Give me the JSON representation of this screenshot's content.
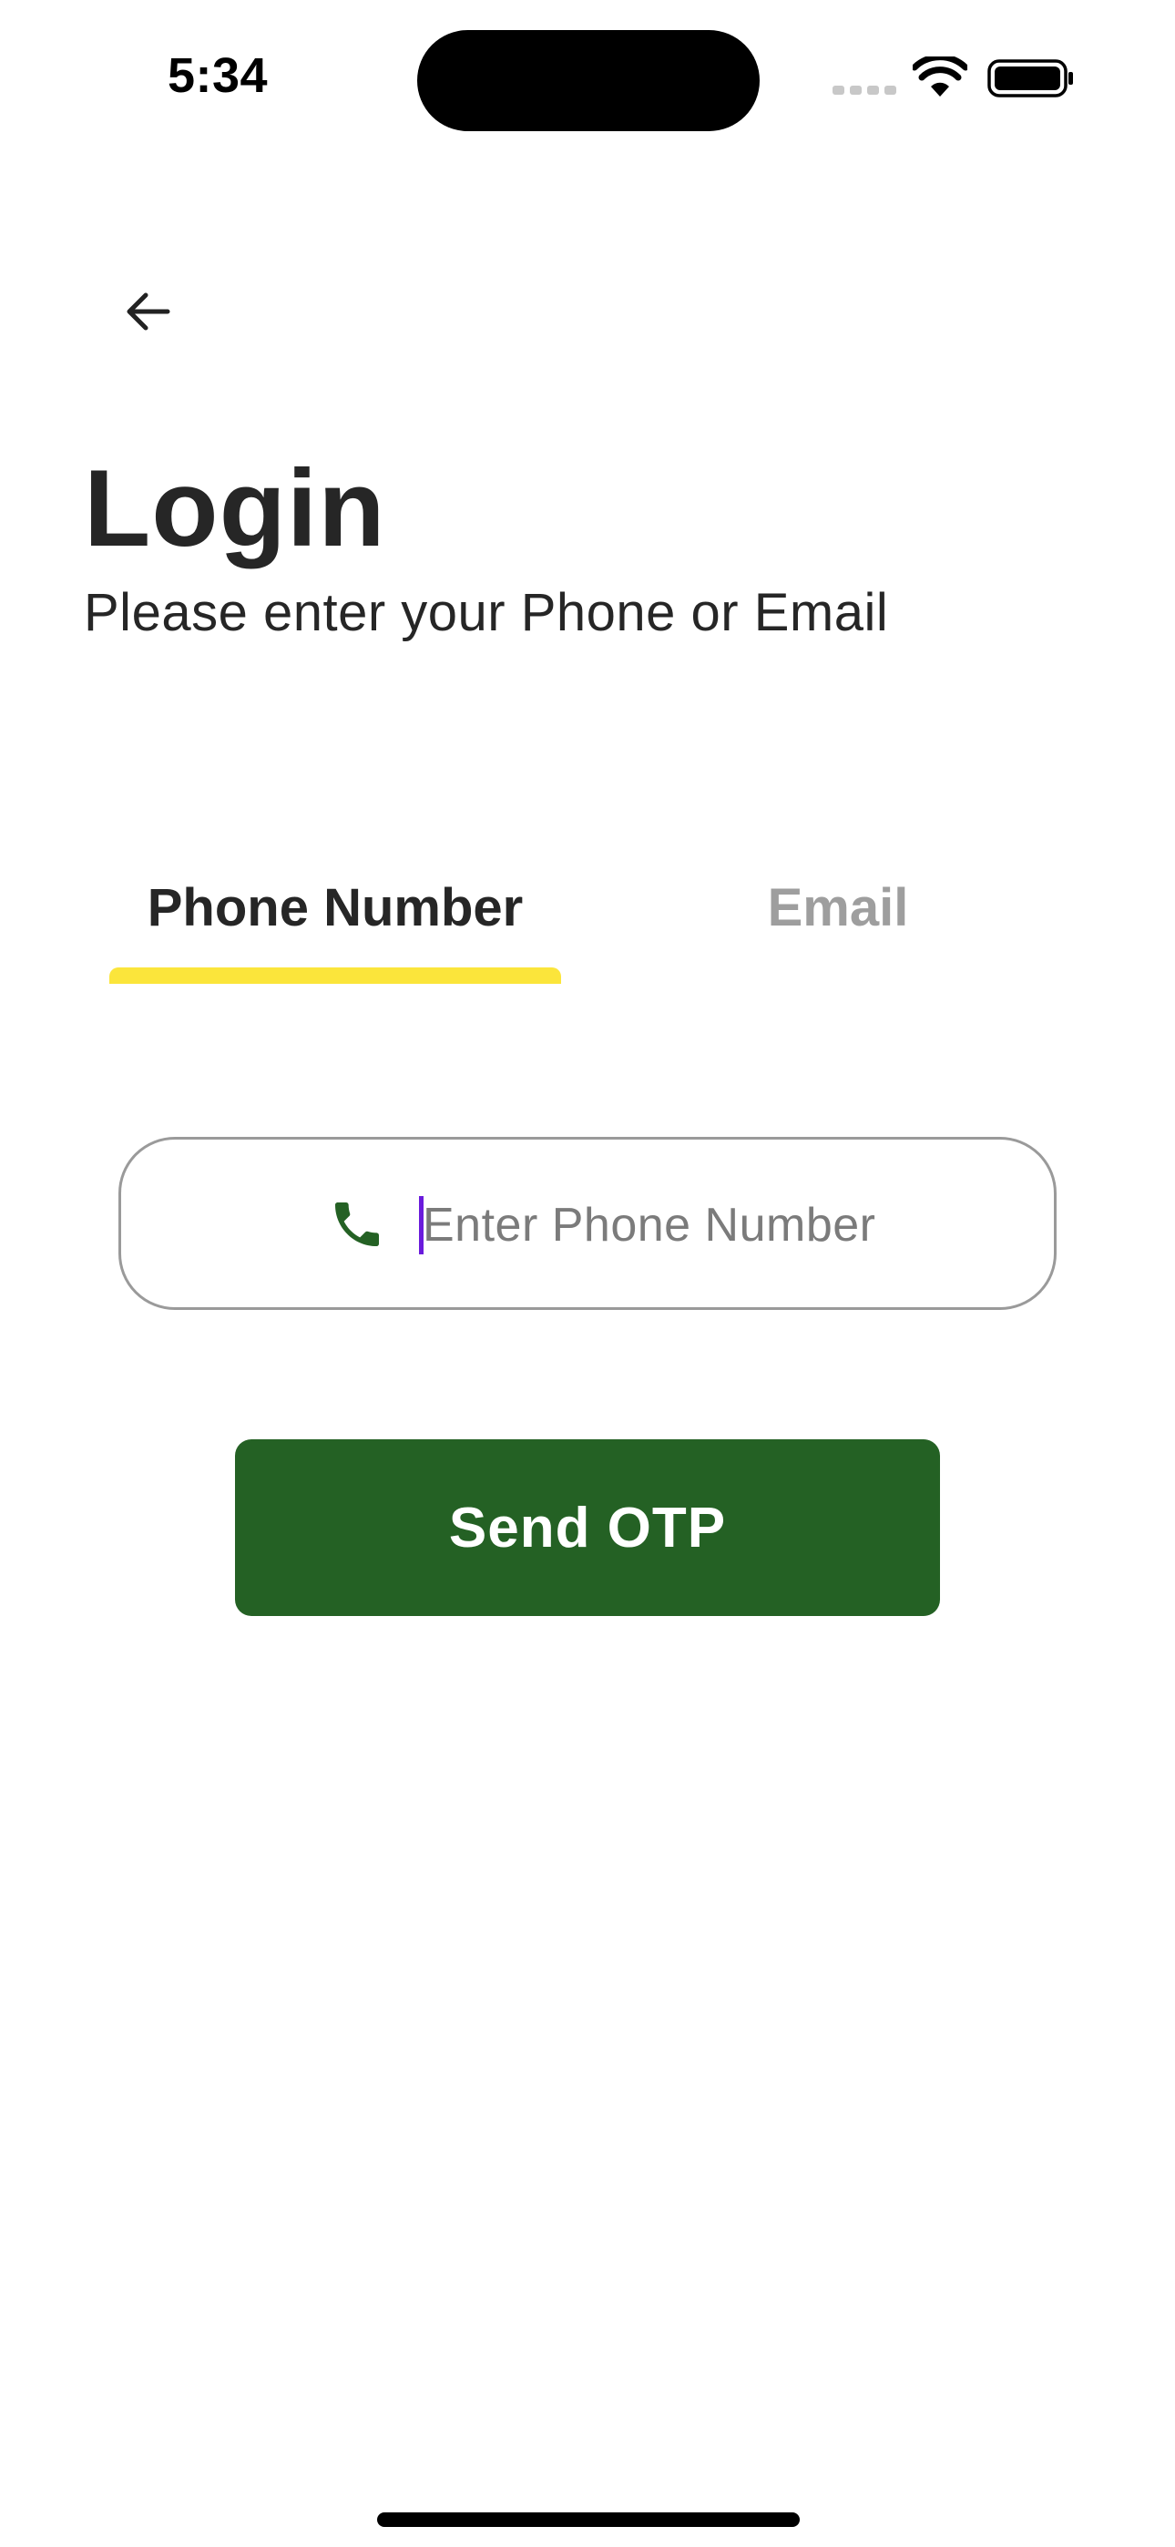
{
  "status_bar": {
    "time": "5:34",
    "icons": [
      "signal-icon",
      "wifi-icon",
      "battery-icon"
    ]
  },
  "header": {
    "back_icon": "arrow-left-icon",
    "title": "Login",
    "subtitle": "Please enter your Phone or Email"
  },
  "tabs": {
    "items": [
      {
        "label": "Phone Number",
        "active": true
      },
      {
        "label": "Email",
        "active": false
      }
    ],
    "indicator_color": "#fbe53b",
    "inactive_color": "#9e9e9e"
  },
  "phone_input": {
    "icon": "phone-icon",
    "value": "",
    "placeholder": "Enter Phone Number",
    "icon_color": "#246124",
    "cursor_color": "#6a1bdc"
  },
  "send_button": {
    "label": "Send OTP",
    "color": "#246124"
  }
}
